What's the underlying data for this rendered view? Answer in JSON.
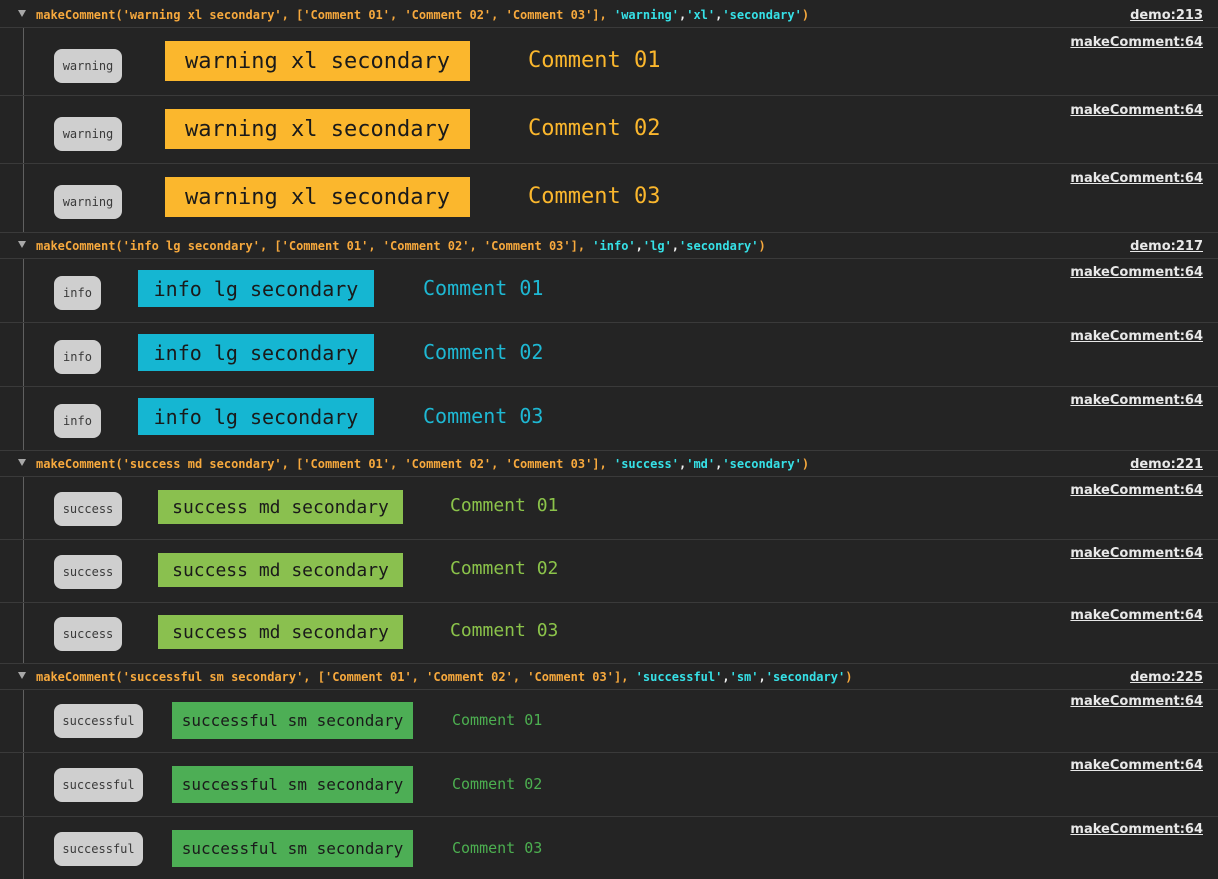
{
  "colors": {
    "warning": "#fbb72d",
    "info": "#15b6d2",
    "success": "#8ac04f",
    "successful": "#4dae55",
    "warning_text": "#fbb72d",
    "info_text": "#1eb8d3",
    "success_text": "#8bc34a",
    "successful_text": "#4caf50"
  },
  "groups": [
    {
      "call_prefix": "makeComment('warning xl secondary', ['Comment 01', 'Comment 02', 'Comment 03'], ",
      "arg1": "'warning'",
      "arg2": "'xl'",
      "arg3": "'secondary'",
      "sep": ",",
      "close": ")",
      "source": "demo:213",
      "rows": [
        {
          "pill": "warning",
          "tag": "warning xl secondary",
          "comment": "Comment 01",
          "source": "makeComment:64"
        },
        {
          "pill": "warning",
          "tag": "warning xl secondary",
          "comment": "Comment 02",
          "source": "makeComment:64"
        },
        {
          "pill": "warning",
          "tag": "warning xl secondary",
          "comment": "Comment 03",
          "source": "makeComment:64"
        }
      ]
    },
    {
      "call_prefix": "makeComment('info lg secondary', ['Comment 01', 'Comment 02', 'Comment 03'], ",
      "arg1": "'info'",
      "arg2": "'lg'",
      "arg3": "'secondary'",
      "sep": ",",
      "close": ")",
      "source": "demo:217",
      "rows": [
        {
          "pill": "info",
          "tag": "info lg secondary",
          "comment": "Comment 01",
          "source": "makeComment:64"
        },
        {
          "pill": "info",
          "tag": "info lg secondary",
          "comment": "Comment 02",
          "source": "makeComment:64"
        },
        {
          "pill": "info",
          "tag": "info lg secondary",
          "comment": "Comment 03",
          "source": "makeComment:64"
        }
      ]
    },
    {
      "call_prefix": "makeComment('success md secondary', ['Comment 01', 'Comment 02', 'Comment 03'], ",
      "arg1": "'success'",
      "arg2": "'md'",
      "arg3": "'secondary'",
      "sep": ",",
      "close": ")",
      "source": "demo:221",
      "rows": [
        {
          "pill": "success",
          "tag": "success md secondary",
          "comment": "Comment 01",
          "source": "makeComment:64"
        },
        {
          "pill": "success",
          "tag": "success md secondary",
          "comment": "Comment 02",
          "source": "makeComment:64"
        },
        {
          "pill": "success",
          "tag": "success md secondary",
          "comment": "Comment 03",
          "source": "makeComment:64"
        }
      ]
    },
    {
      "call_prefix": "makeComment('successful sm secondary', ['Comment 01', 'Comment 02', 'Comment 03'], ",
      "arg1": "'successful'",
      "arg2": "'sm'",
      "arg3": "'secondary'",
      "sep": ",",
      "close": ")",
      "source": "demo:225",
      "rows": [
        {
          "pill": "successful",
          "tag": "successful sm secondary",
          "comment": "Comment 01",
          "source": "makeComment:64"
        },
        {
          "pill": "successful",
          "tag": "successful sm secondary",
          "comment": "Comment 02",
          "source": "makeComment:64"
        },
        {
          "pill": "successful",
          "tag": "successful sm secondary",
          "comment": "Comment 03",
          "source": "makeComment:64"
        }
      ]
    }
  ]
}
